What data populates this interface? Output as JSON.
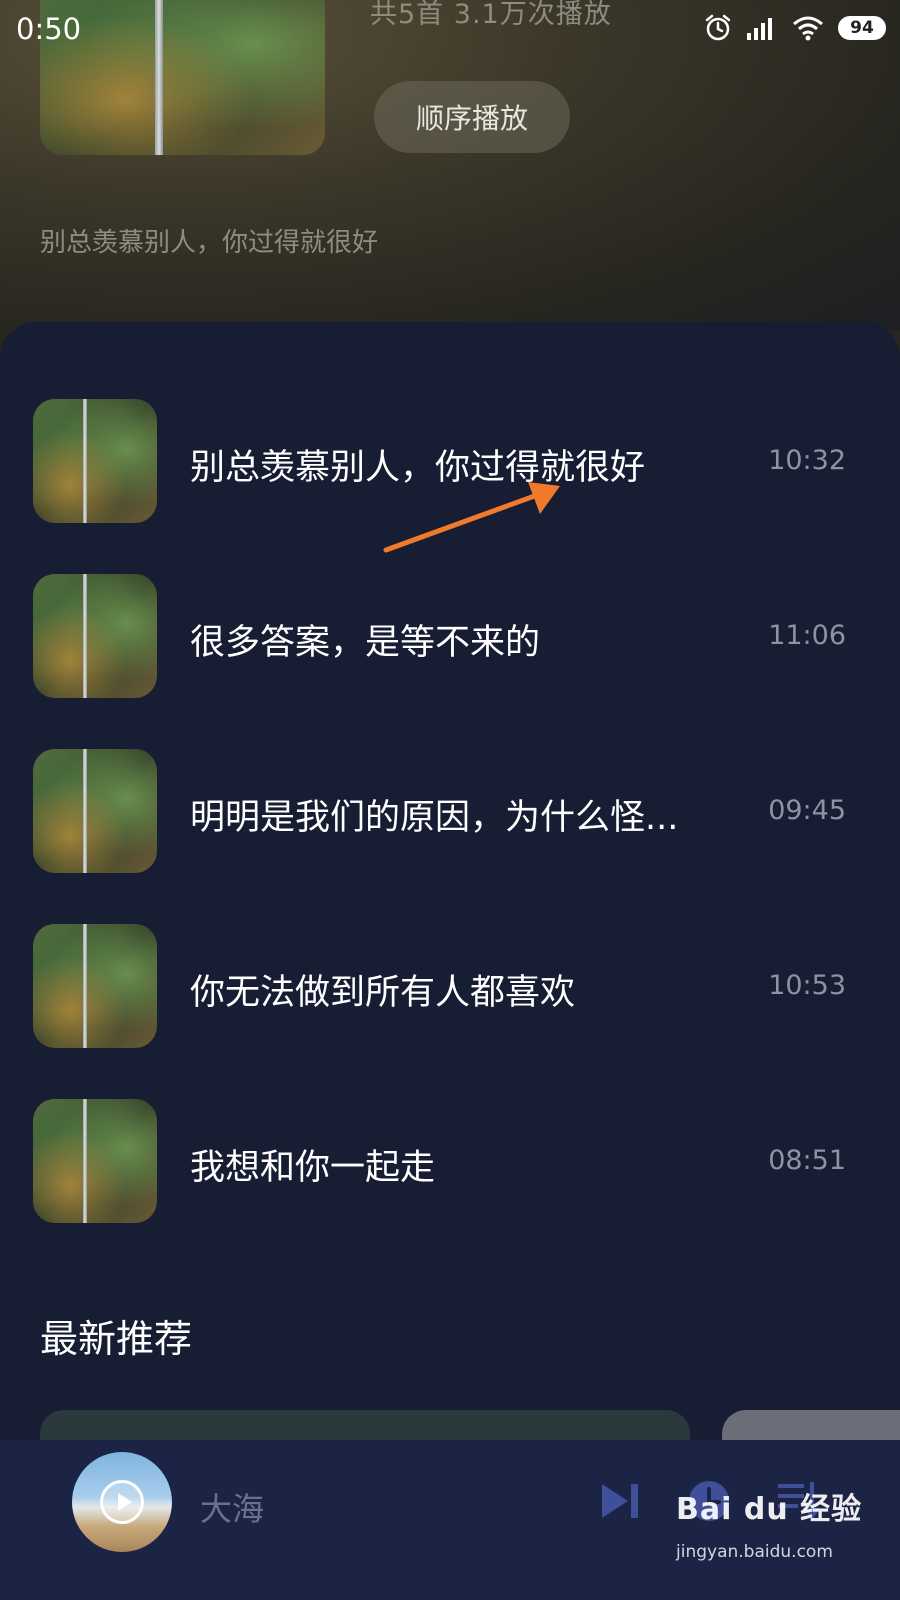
{
  "status_bar": {
    "time": "0:50",
    "battery": "94"
  },
  "playlist": {
    "stats": "共5首   3.1万次播放",
    "play_order_label": "顺序播放",
    "description": "别总羡慕别人，你过得就很好"
  },
  "tracks": [
    {
      "title": "别总羡慕别人，你过得就很好",
      "duration": "10:32"
    },
    {
      "title": "很多答案，是等不来的",
      "duration": "11:06"
    },
    {
      "title": "明明是我们的原因，为什么怪...",
      "duration": "09:45"
    },
    {
      "title": "你无法做到所有人都喜欢",
      "duration": "10:53"
    },
    {
      "title": "我想和你一起走",
      "duration": "08:51"
    }
  ],
  "section": {
    "title": "最新推荐"
  },
  "player": {
    "now_playing": "大海"
  },
  "watermark": {
    "brand": "Bai du 经验",
    "url": "jingyan.baidu.com"
  },
  "colors": {
    "panel_bg": "#171d33",
    "player_bg": "#1c2446",
    "arrow": "#f07a2c",
    "icon": "#3f4f9a"
  }
}
